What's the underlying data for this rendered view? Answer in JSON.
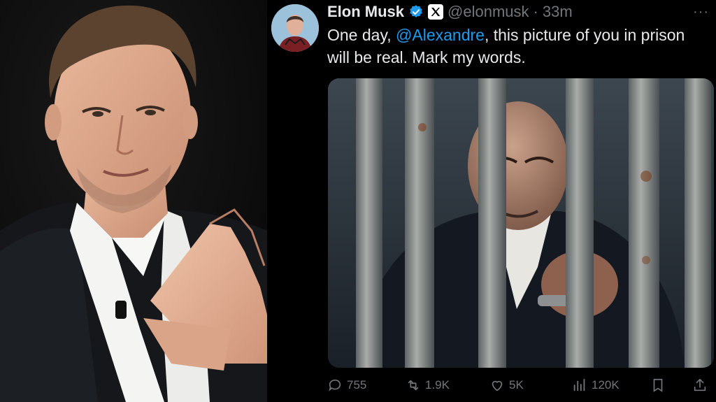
{
  "tweet": {
    "author_name": "Elon Musk",
    "author_handle": "@elonmusk",
    "separator": "·",
    "time": "33m",
    "more_label": "···",
    "text_before": "One day, ",
    "mention": "@Alexandre",
    "text_after": ", this picture of you in prison will be real. Mark my words.",
    "stats": {
      "replies": "755",
      "reposts": "1.9K",
      "likes": "5K",
      "views": "120K"
    }
  },
  "colors": {
    "accent": "#1d9bf0",
    "secondary_text": "#71767b",
    "primary_text": "#e7e9ea",
    "background": "#000000"
  },
  "icons": [
    "verified-badge-icon",
    "x-logo-icon",
    "more-icon",
    "reply-icon",
    "repost-icon",
    "like-icon",
    "views-icon",
    "bookmark-icon",
    "share-icon"
  ]
}
